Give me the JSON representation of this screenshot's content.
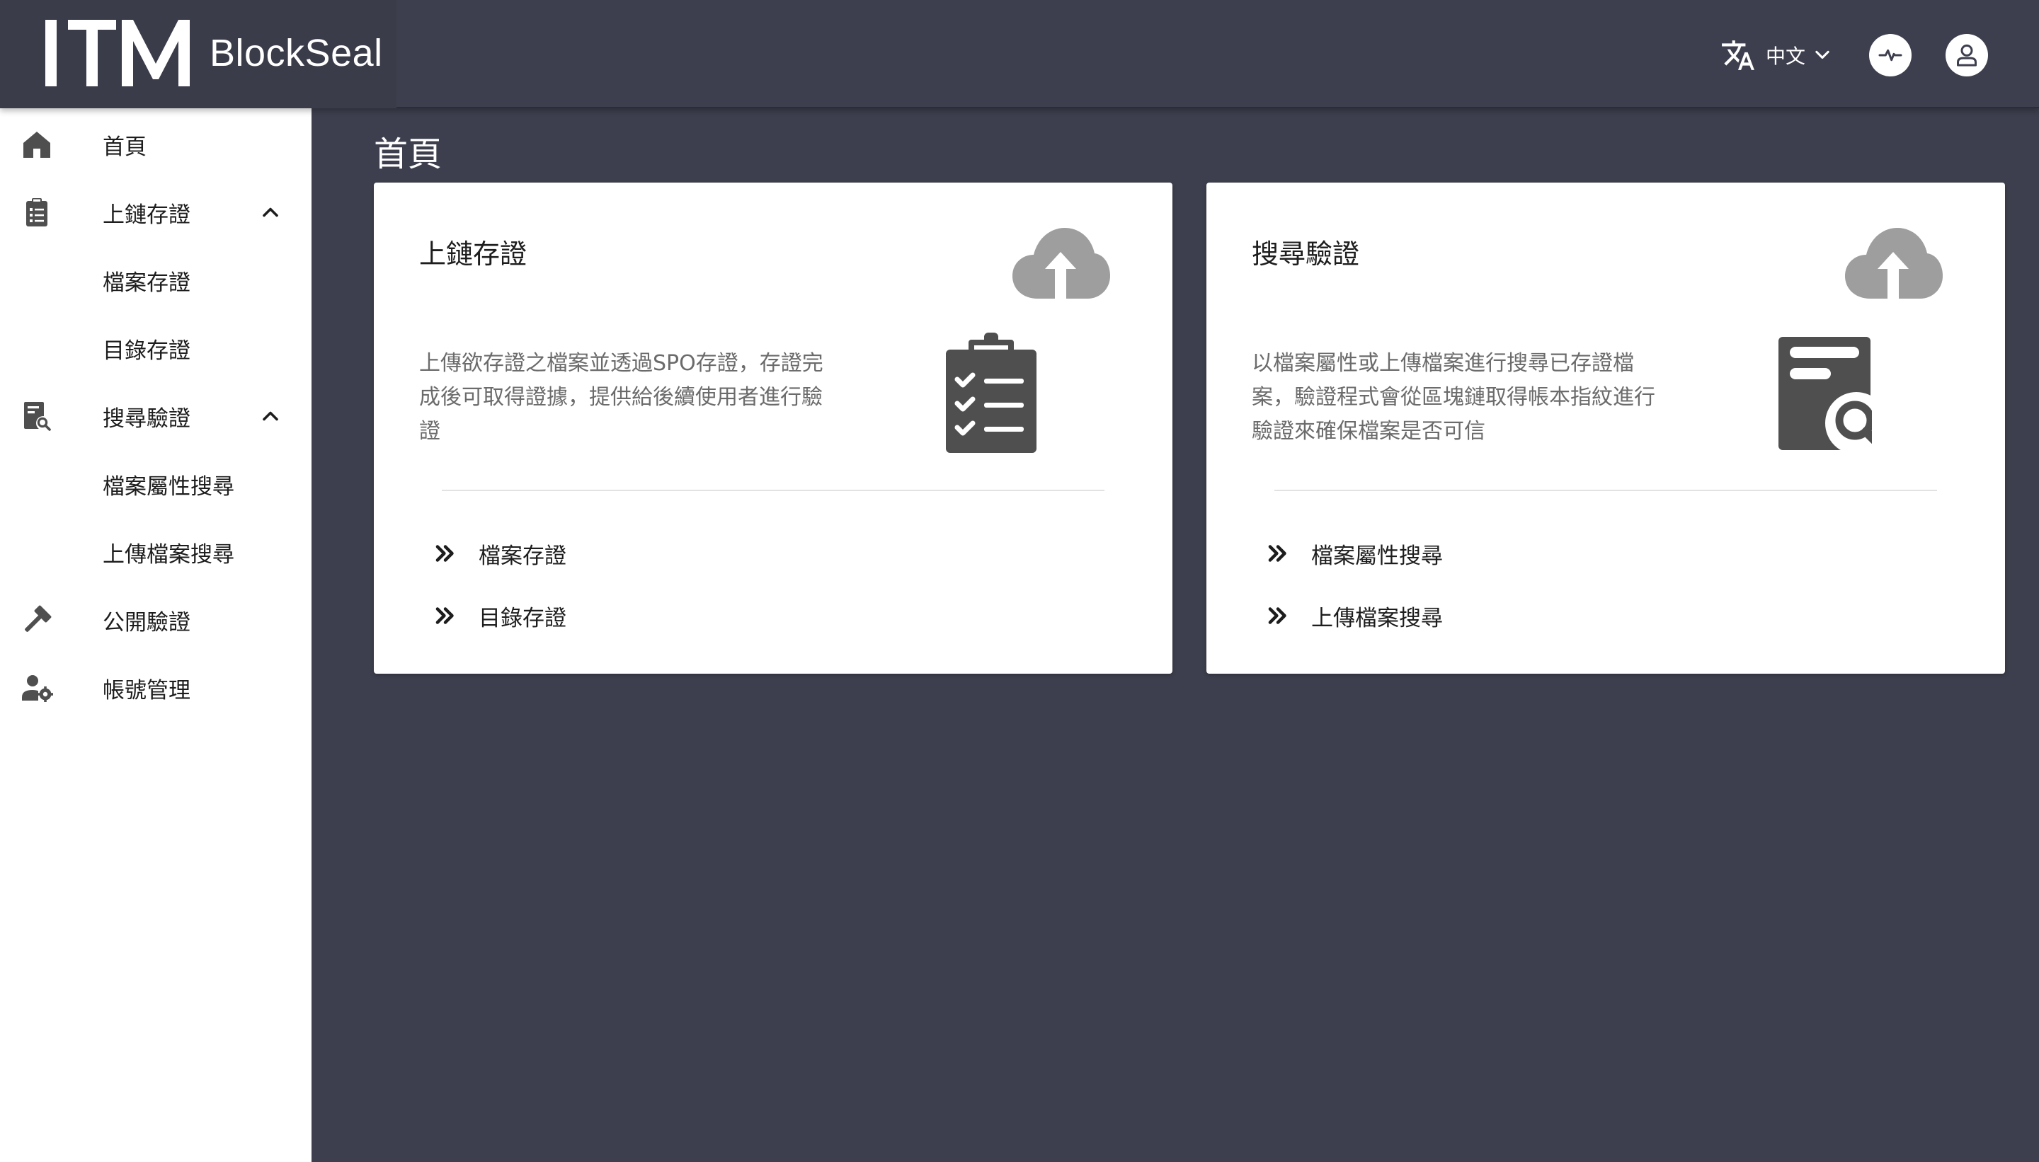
{
  "header": {
    "brand_mark": "ITM",
    "brand_name": "BlockSeal",
    "language": "中文",
    "icons": [
      "translate-icon",
      "chevron-down-icon",
      "pulse-icon",
      "user-icon"
    ]
  },
  "sidebar": {
    "items": [
      {
        "label": "首頁",
        "icon": "home-icon"
      },
      {
        "label": "上鏈存證",
        "icon": "clipboard-list-icon",
        "expanded": true
      },
      {
        "label": "檔案存證"
      },
      {
        "label": "目錄存證"
      },
      {
        "label": "搜尋驗證",
        "icon": "file-search-icon",
        "expanded": true
      },
      {
        "label": "檔案屬性搜尋"
      },
      {
        "label": "上傳檔案搜尋"
      },
      {
        "label": "公開驗證",
        "icon": "gavel-icon"
      },
      {
        "label": "帳號管理",
        "icon": "user-gear-icon"
      }
    ]
  },
  "main": {
    "title": "首頁",
    "cards": [
      {
        "title": "上鏈存證",
        "description": "上傳欲存證之檔案並透過SPO存證，存證完成後可取得證據，提供給後續使用者進行驗證",
        "icon": "clipboard-check-icon",
        "links": [
          "檔案存證",
          "目錄存證"
        ]
      },
      {
        "title": "搜尋驗證",
        "description": "以檔案屬性或上傳檔案進行搜尋已存證檔案，驗證程式會從區塊鏈取得帳本指紋進行驗證來確保檔案是否可信",
        "icon": "file-search-icon",
        "links": [
          "檔案屬性搜尋",
          "上傳檔案搜尋"
        ]
      }
    ]
  },
  "colors": {
    "background": "#3d3f4e",
    "sidebar": "#ffffff",
    "card": "#ffffff",
    "icon_gray": "#4f4f4f",
    "cloud_gray": "#9e9e9e",
    "description_text": "#6b6b6b"
  }
}
